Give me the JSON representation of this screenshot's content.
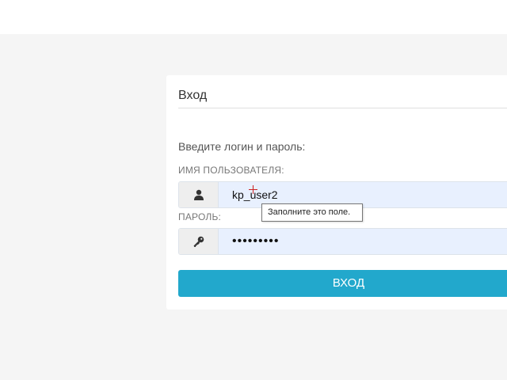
{
  "login": {
    "title": "Вход",
    "prompt": "Введите логин и пароль:",
    "username": {
      "label": "ИМЯ ПОЛЬЗОВАТЕЛЯ:",
      "value": "kp_user2",
      "icon": "user-icon"
    },
    "password": {
      "label": "ПАРОЛЬ:",
      "value": "•••••••••",
      "icon": "key-icon"
    },
    "submit_label": "ВХОД"
  },
  "tooltip": {
    "text": "Заполните это поле."
  },
  "colors": {
    "accent": "#22a8cc",
    "input_fill": "#e8f0fe",
    "background": "#f5f5f5"
  }
}
